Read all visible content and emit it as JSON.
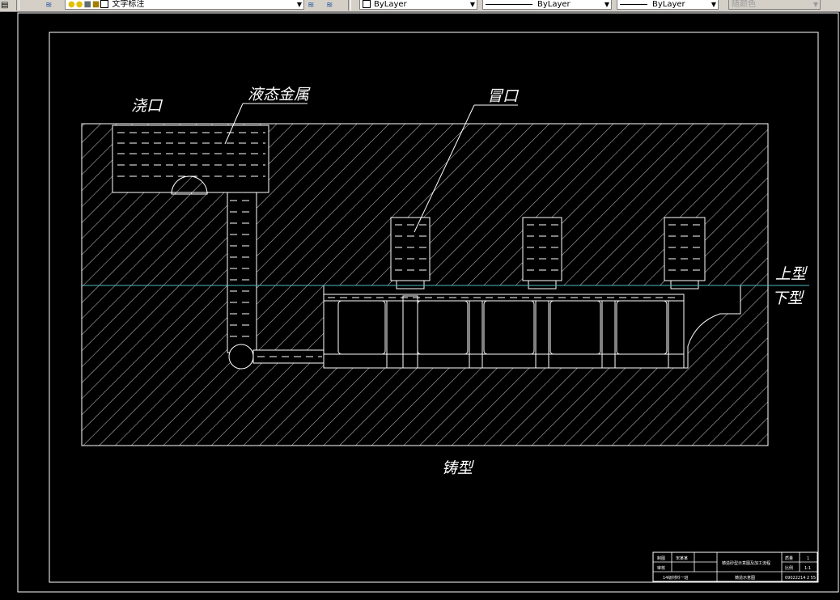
{
  "toolbar": {
    "layer_name": "文字标注",
    "color_label": "ByLayer",
    "linetype_label": "ByLayer",
    "lineweight_label": "ByLayer",
    "plotstyle_label": "随颜色"
  },
  "drawing": {
    "labels": {
      "sprue": "浇口",
      "liquid_metal": "液态金属",
      "riser": "冒口",
      "upper_mold": "上型",
      "lower_mold": "下型",
      "mold": "铸型"
    },
    "title_block": {
      "r1c1": "制图",
      "r1c2": "宋某某",
      "r2c1": "审核",
      "center": "铸造砂型示意图及加工流程",
      "bottom_left": "14级材料一班",
      "bottom_mid": "铸造示意图",
      "weight_label": "质量",
      "weight_value": "1",
      "scale_label": "比例",
      "scale_value": "1:1",
      "number": "09022214 2 55"
    }
  },
  "colors": {
    "background": "#000000",
    "lines": "#ffffff",
    "parting_line": "#4fb7c0"
  }
}
